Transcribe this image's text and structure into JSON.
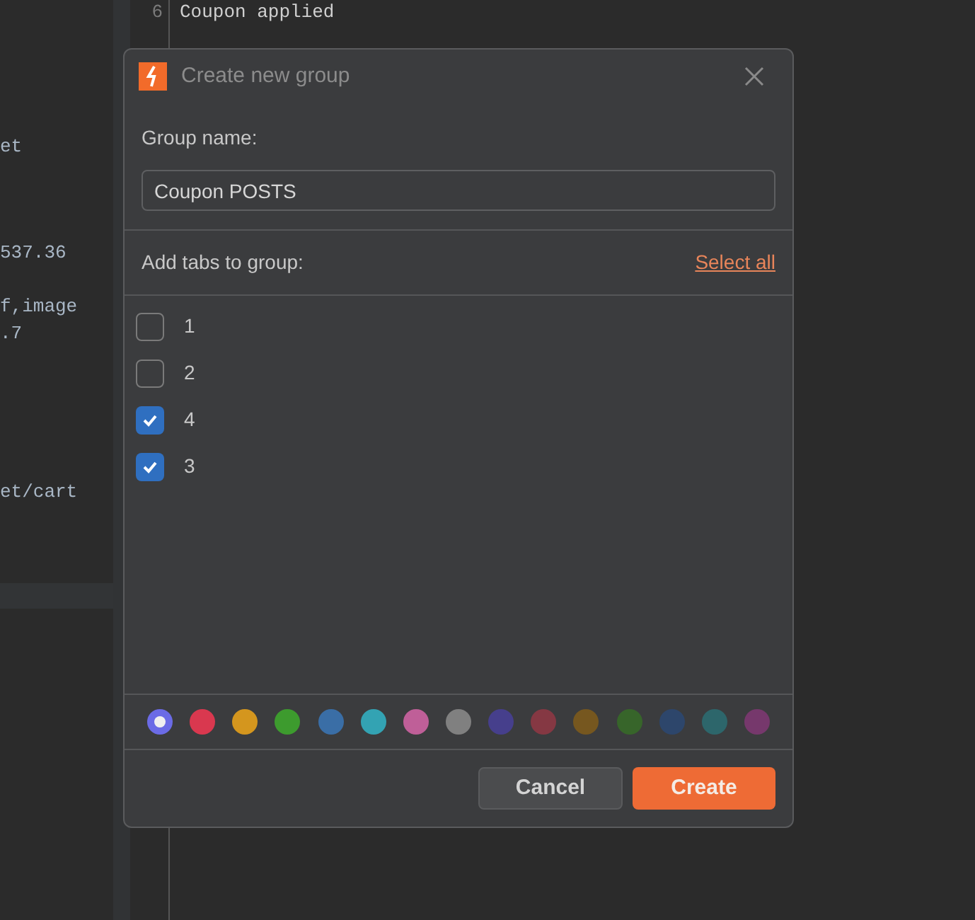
{
  "editor_left": {
    "lines": [
      {
        "text": "et"
      },
      {
        "text": "537.36"
      },
      {
        "text": "f,image"
      },
      {
        "text": ".7"
      },
      {
        "text": "et/cart"
      }
    ]
  },
  "editor_right": {
    "lines": [
      {
        "number": "6",
        "text": "Coupon applied"
      }
    ]
  },
  "dialog": {
    "title": "Create new group",
    "group_name_label": "Group name:",
    "group_name_value": "Coupon POSTS",
    "tabs_label": "Add tabs to group:",
    "select_all": "Select all",
    "tabs": [
      {
        "label": "1",
        "checked": false
      },
      {
        "label": "2",
        "checked": false
      },
      {
        "label": "4",
        "checked": true
      },
      {
        "label": "3",
        "checked": true
      }
    ],
    "colors": [
      {
        "color": "#6b6be6",
        "selected": true
      },
      {
        "color": "#d9384f",
        "selected": false
      },
      {
        "color": "#d4961e",
        "selected": false
      },
      {
        "color": "#3d9b2e",
        "selected": false
      },
      {
        "color": "#3a6ea6",
        "selected": false
      },
      {
        "color": "#33a3b3",
        "selected": false
      },
      {
        "color": "#bf5f98",
        "selected": false
      },
      {
        "color": "#808080",
        "selected": false
      },
      {
        "color": "#463f8c",
        "selected": false
      },
      {
        "color": "#853843",
        "selected": false
      },
      {
        "color": "#76571f",
        "selected": false
      },
      {
        "color": "#37652a",
        "selected": false
      },
      {
        "color": "#2d466b",
        "selected": false
      },
      {
        "color": "#2d666b",
        "selected": false
      },
      {
        "color": "#76386c",
        "selected": false
      }
    ],
    "buttons": [
      {
        "label": "Cancel",
        "kind": "secondary"
      },
      {
        "label": "Create",
        "kind": "primary"
      }
    ]
  }
}
